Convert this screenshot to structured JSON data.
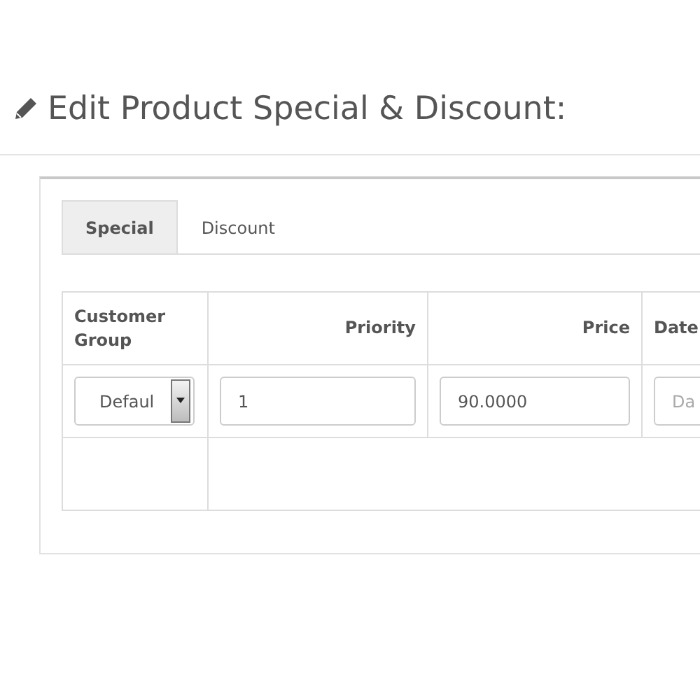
{
  "page_title": "Edit Product Special & Discount:",
  "tabs": [
    {
      "label": "Special",
      "selected": true
    },
    {
      "label": "Discount",
      "selected": false
    }
  ],
  "table": {
    "columns": [
      {
        "label": "Customer Group"
      },
      {
        "label": "Priority"
      },
      {
        "label": "Price"
      },
      {
        "label": "Date"
      }
    ],
    "rows": [
      {
        "customer_group": {
          "value": "Defaul"
        },
        "priority": {
          "value": "1"
        },
        "price": {
          "value": "90.0000"
        },
        "date_start": {
          "placeholder": "Da"
        }
      }
    ]
  }
}
